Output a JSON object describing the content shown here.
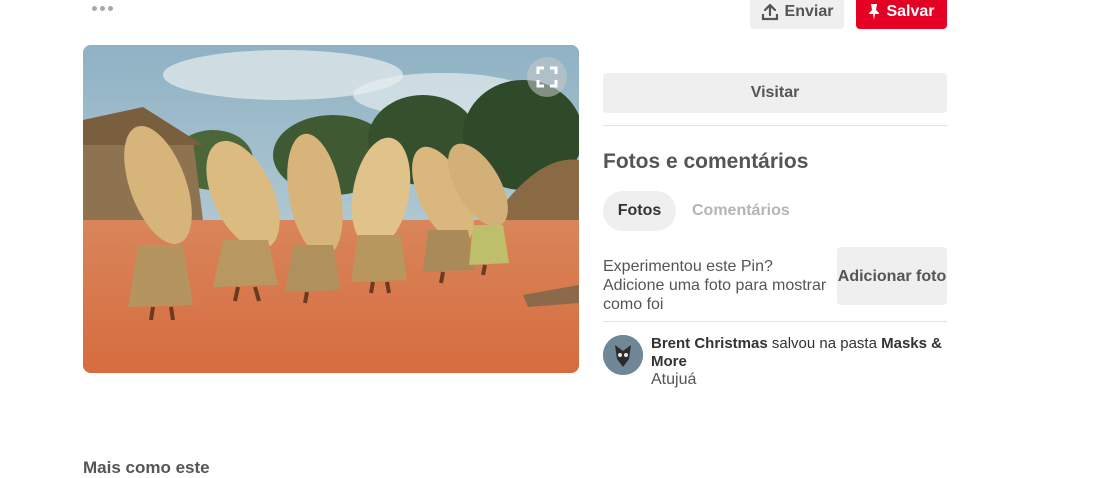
{
  "toolbar": {
    "more_icon": "more-dots-icon",
    "send_label": "Enviar",
    "send_icon": "upload-icon",
    "save_label": "Salvar",
    "save_icon": "pin-icon"
  },
  "pin": {
    "expand_icon": "expand-icon"
  },
  "details": {
    "visit_label": "Visitar",
    "section_title": "Fotos e comentários",
    "tabs": [
      {
        "label": "Fotos",
        "active": true
      },
      {
        "label": "Comentários",
        "active": false
      }
    ],
    "try_prompt": "Experimentou este Pin? Adicione uma foto para mostrar como foi",
    "add_photo_label": "Adicionar foto",
    "saved": {
      "user": "Brent Christmas",
      "action": " salvou na pasta ",
      "board": "Masks & More",
      "subtitle": "Atujuá"
    }
  },
  "more_like_title": "Mais como este",
  "colors": {
    "accent": "#e60023",
    "button_bg": "#efefef",
    "text_dark": "#555555",
    "text_muted": "#b5b5b5"
  }
}
